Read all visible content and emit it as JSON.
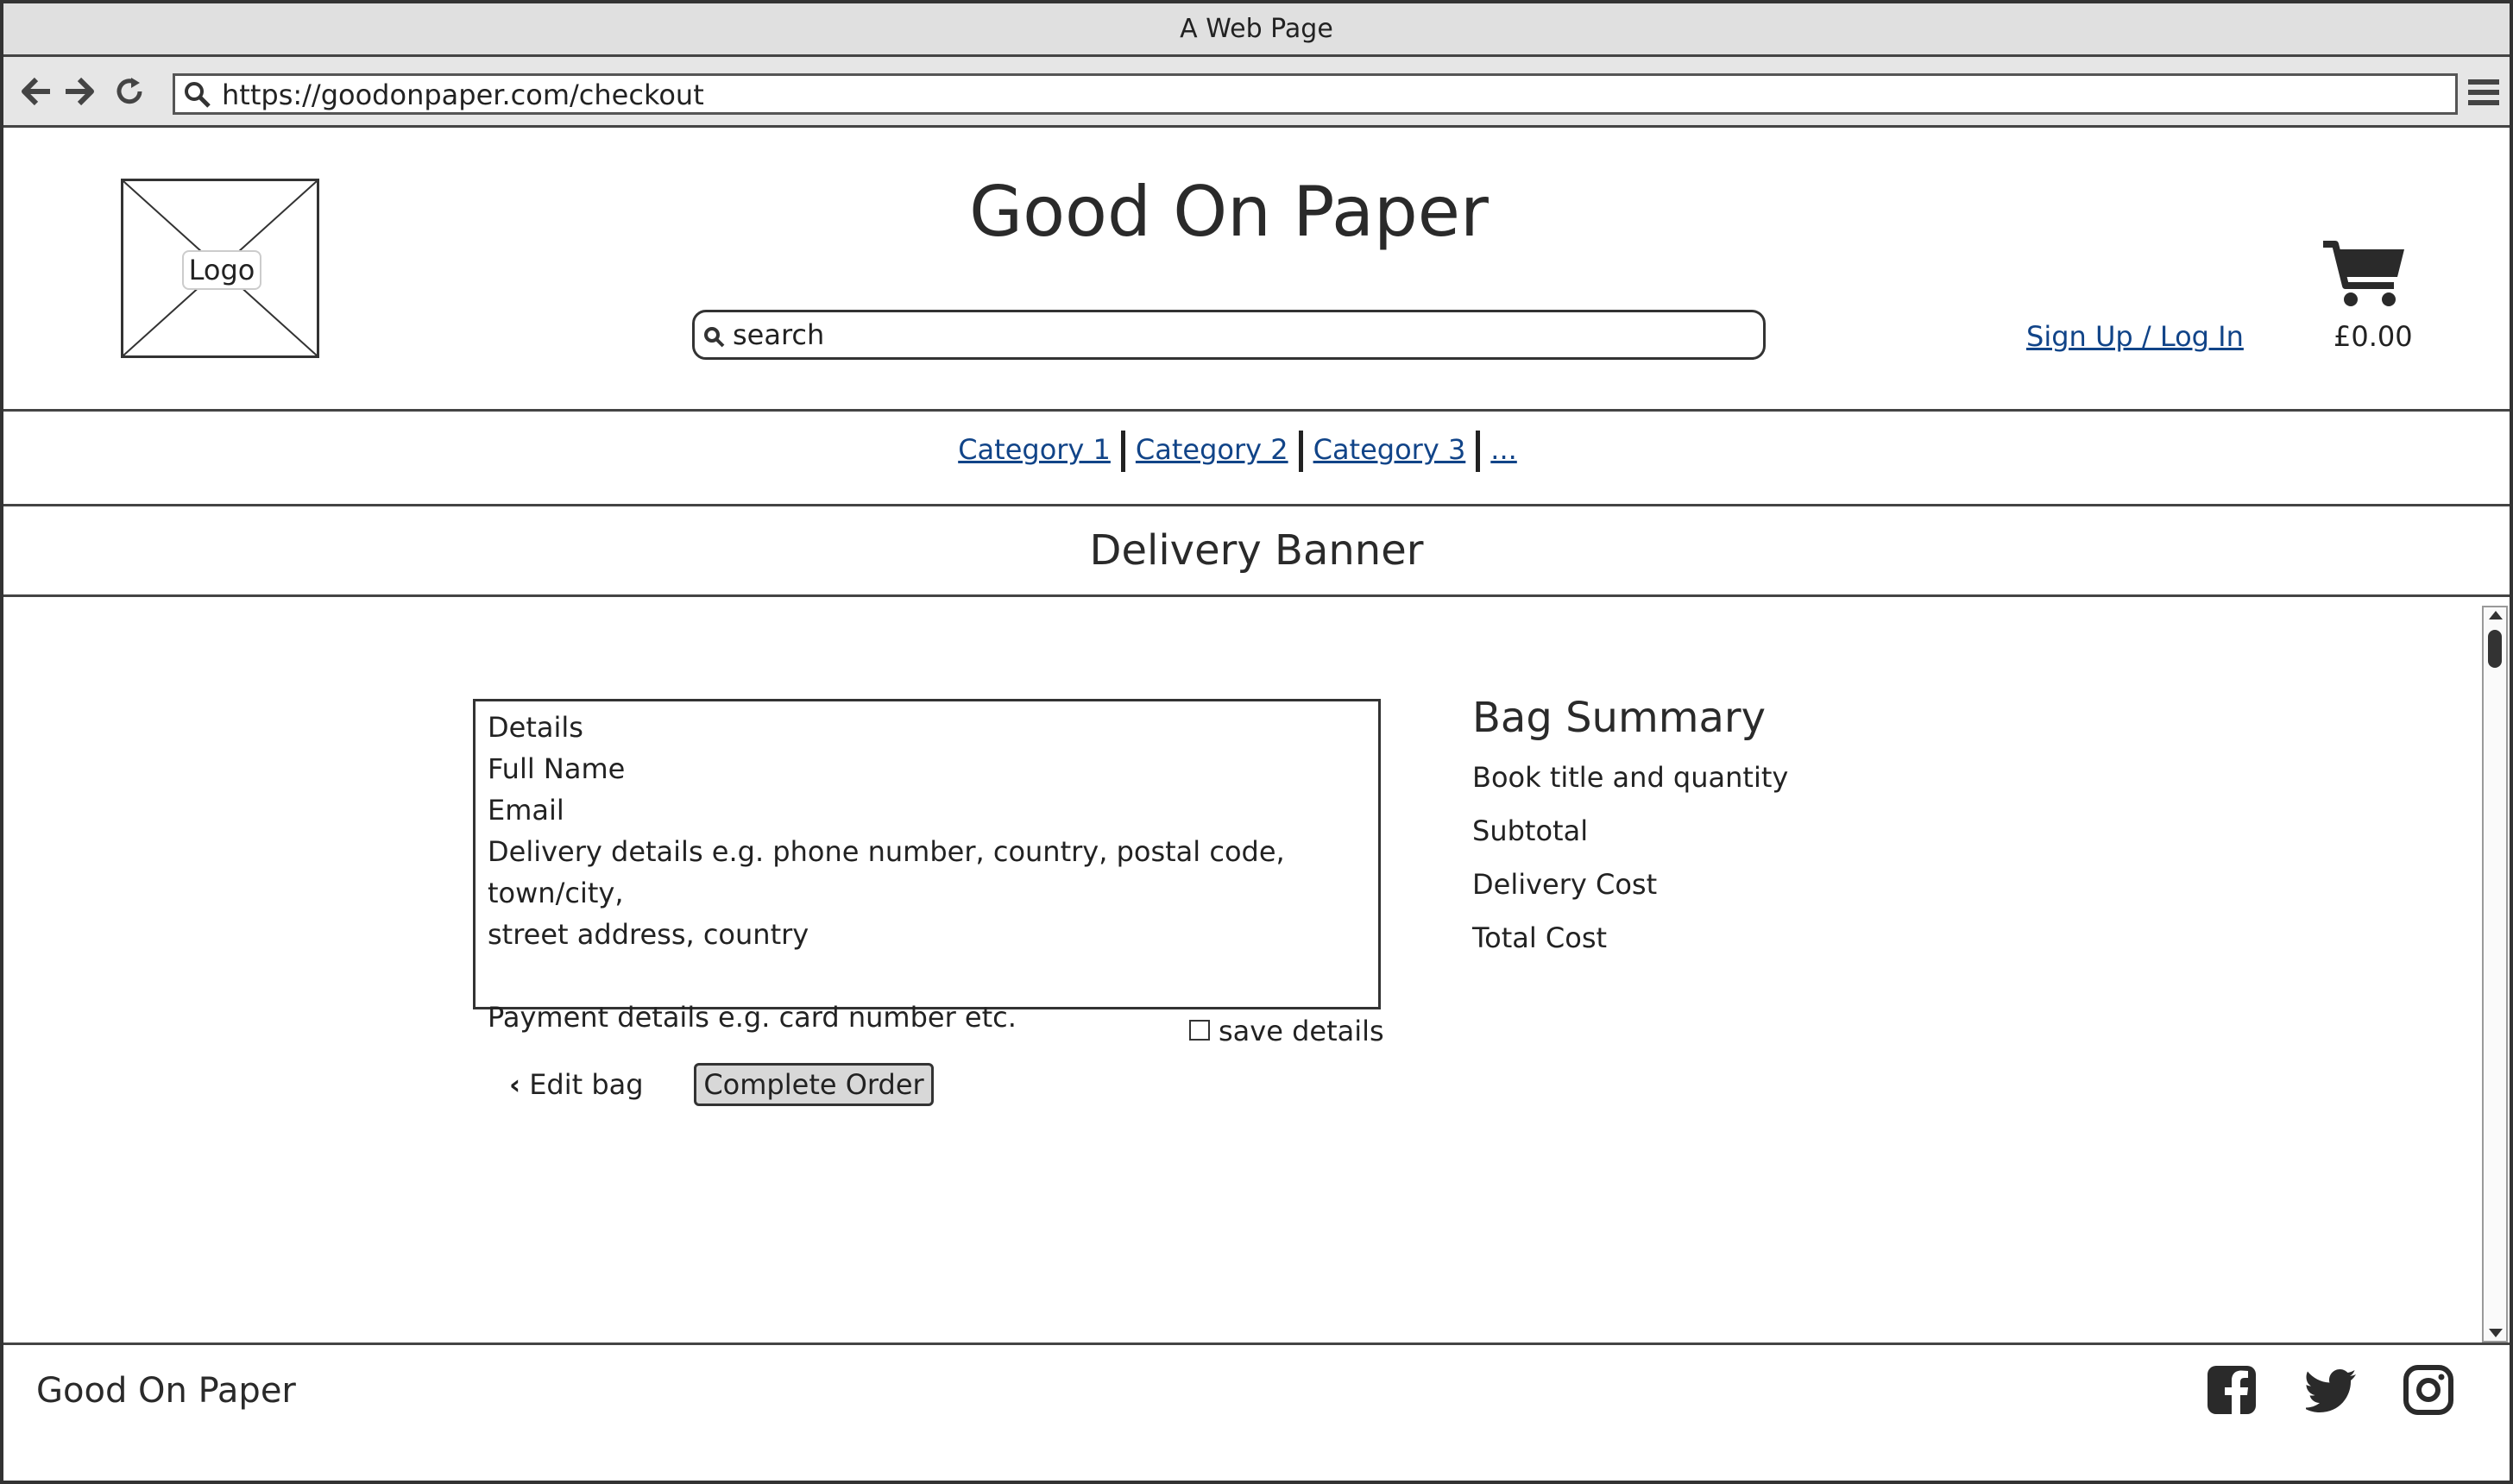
{
  "browser": {
    "window_title": "A Web Page",
    "url": "https://goodonpaper.com/checkout"
  },
  "header": {
    "logo_label": "Logo",
    "site_title": "Good On Paper",
    "search_placeholder": "search",
    "signup_link": "Sign Up / Log In",
    "cart_total": "£0.00"
  },
  "categories": [
    "Category 1",
    "Category 2",
    "Category 3",
    "..."
  ],
  "banner": "Delivery Banner",
  "checkout": {
    "details_lines": [
      "Details",
      "Full Name",
      "Email",
      "Delivery details e.g. phone number, country, postal code, town/city,",
      "street address, country",
      "",
      "Payment details e.g. card number etc."
    ],
    "save_details_label": "save details",
    "save_details_checked": false,
    "edit_bag_label": "Edit bag",
    "complete_order_label": "Complete Order"
  },
  "summary": {
    "title": "Bag Summary",
    "lines": [
      "Book title and quantity",
      "Subtotal",
      "Delivery Cost",
      "Total Cost"
    ]
  },
  "footer": {
    "title": "Good On Paper",
    "social_icons": [
      "facebook-icon",
      "twitter-icon",
      "instagram-icon"
    ]
  }
}
